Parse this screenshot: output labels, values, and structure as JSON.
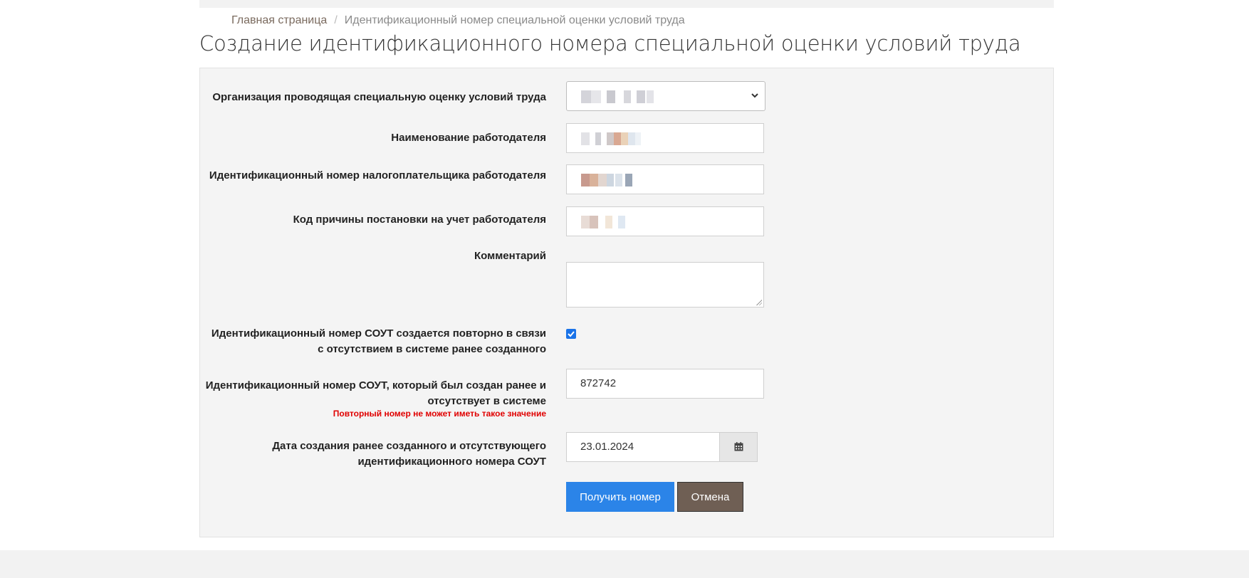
{
  "breadcrumb": {
    "home": "Главная страница",
    "separator": "/",
    "current": "Идентификационный номер специальной оценки условий труда"
  },
  "page_title": "Создание идентификационного номера специальной оценки условий труда",
  "form": {
    "organization_label": "Организация проводящая специальную оценку условий труда",
    "employer_name_label": "Наименование работодателя",
    "inn_label": "Идентификационный номер налогоплательщика работодателя",
    "kpp_label": "Код причины постановки на учет работодателя",
    "comment_label": "Комментарий",
    "repeat_label": "Идентификационный номер СОУТ создается повторно в связи с отсутствием в системе ранее созданного",
    "repeat_checked": true,
    "previous_number_label": "Идентификационный номер СОУТ, который был создан ранее и отсутствует в системе",
    "previous_number_value": "872742",
    "previous_number_error": "Повторный номер не может иметь такое значение",
    "date_label": "Дата создания ранее созданного и отсутствующего идентификационного номера СОУТ",
    "date_value": "23.01.2024",
    "submit_label": "Получить номер",
    "cancel_label": "Отмена"
  },
  "icons": {
    "select_chevron": "chevron-down-icon",
    "calendar": "calendar-icon",
    "checkbox_check": "check-icon"
  },
  "colors": {
    "primary_button": "#2b84e8",
    "cancel_button": "#6f5f54",
    "error_text": "#e00000",
    "panel_background": "#f4f4f4"
  }
}
